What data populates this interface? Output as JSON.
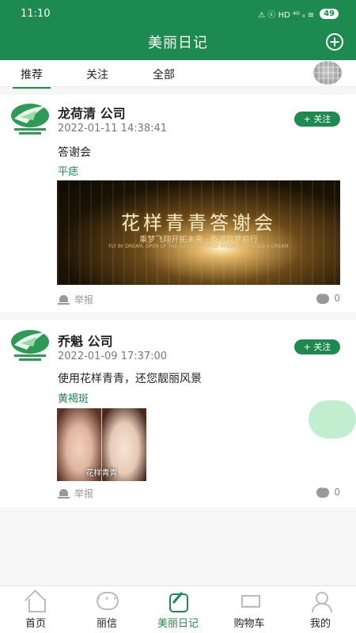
{
  "status_bar": {
    "time": "11:10",
    "icons": "⚠ ⓒ HD ⁴ᴳ ᵢₗ ≋",
    "battery": "49"
  },
  "header": {
    "title": "美丽日记",
    "add_icon": "plus-circle-icon"
  },
  "tabs": [
    {
      "label": "推荐",
      "active": true
    },
    {
      "label": "关注",
      "active": false
    },
    {
      "label": "全部",
      "active": false
    }
  ],
  "posts": [
    {
      "author": "龙荷清 公司",
      "date": "2022-01-11 14:38:41",
      "follow_label": "+ 关注",
      "content": "答谢会",
      "tag": "平痣",
      "image": {
        "title": "花样青青答谢会",
        "subtitle": "乘梦飞翔开拓未来 · 奋进筑梦前行",
        "subtitle_en": "FLY BY DREAM, OPEN UP THE FUTURE · FORGE AHEAD AND BUILD A DREAM"
      },
      "report_label": "举报",
      "comment_count": "0"
    },
    {
      "author": "乔魁 公司",
      "date": "2022-01-09 17:37:00",
      "follow_label": "+ 关注",
      "content": "使用花样青青，还您靓丽风景",
      "tag": "黄褐斑",
      "image": {
        "caption": "花样青青"
      },
      "report_label": "举报",
      "comment_count": "0"
    }
  ],
  "bottom_nav": [
    {
      "label": "首页",
      "icon": "home-icon",
      "active": false
    },
    {
      "label": "丽信",
      "icon": "chat-icon",
      "active": false
    },
    {
      "label": "美丽日记",
      "icon": "diary-icon",
      "active": true
    },
    {
      "label": "购物车",
      "icon": "cart-icon",
      "active": false
    },
    {
      "label": "我的",
      "icon": "user-icon",
      "active": false
    }
  ],
  "colors": {
    "brand": "#1d8a4f",
    "tag": "#1d8a4f",
    "background": "#f6f6f6"
  }
}
